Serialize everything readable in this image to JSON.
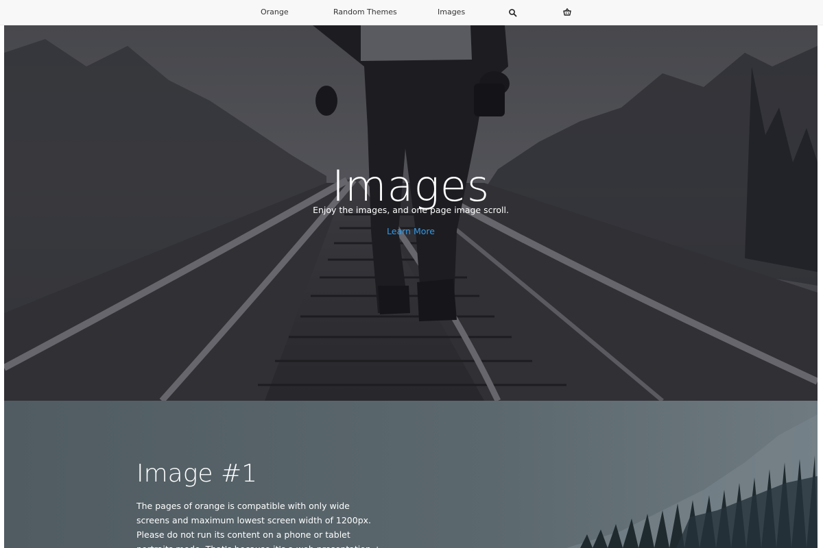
{
  "nav": {
    "items": [
      {
        "label": "Orange"
      },
      {
        "label": "Random Themes"
      },
      {
        "label": "Images"
      }
    ],
    "icons": [
      "search-icon",
      "basket-icon"
    ]
  },
  "hero": {
    "title": "Images",
    "subtitle": "Enjoy the images, and one page image scroll.",
    "link": "Learn More"
  },
  "section": {
    "heading": "Image #1",
    "body": "The pages of orange is compatible with only wide screens and maximum lowest screen width of 1200px. Please do not run its content on a phone or tablet portraits mode. That's because it's a web presentation + ecommerce + showcase"
  },
  "colors": {
    "nav_bg": "#f8f8f8",
    "link": "#3399e6",
    "hero_overlay": "#2a2c33"
  }
}
